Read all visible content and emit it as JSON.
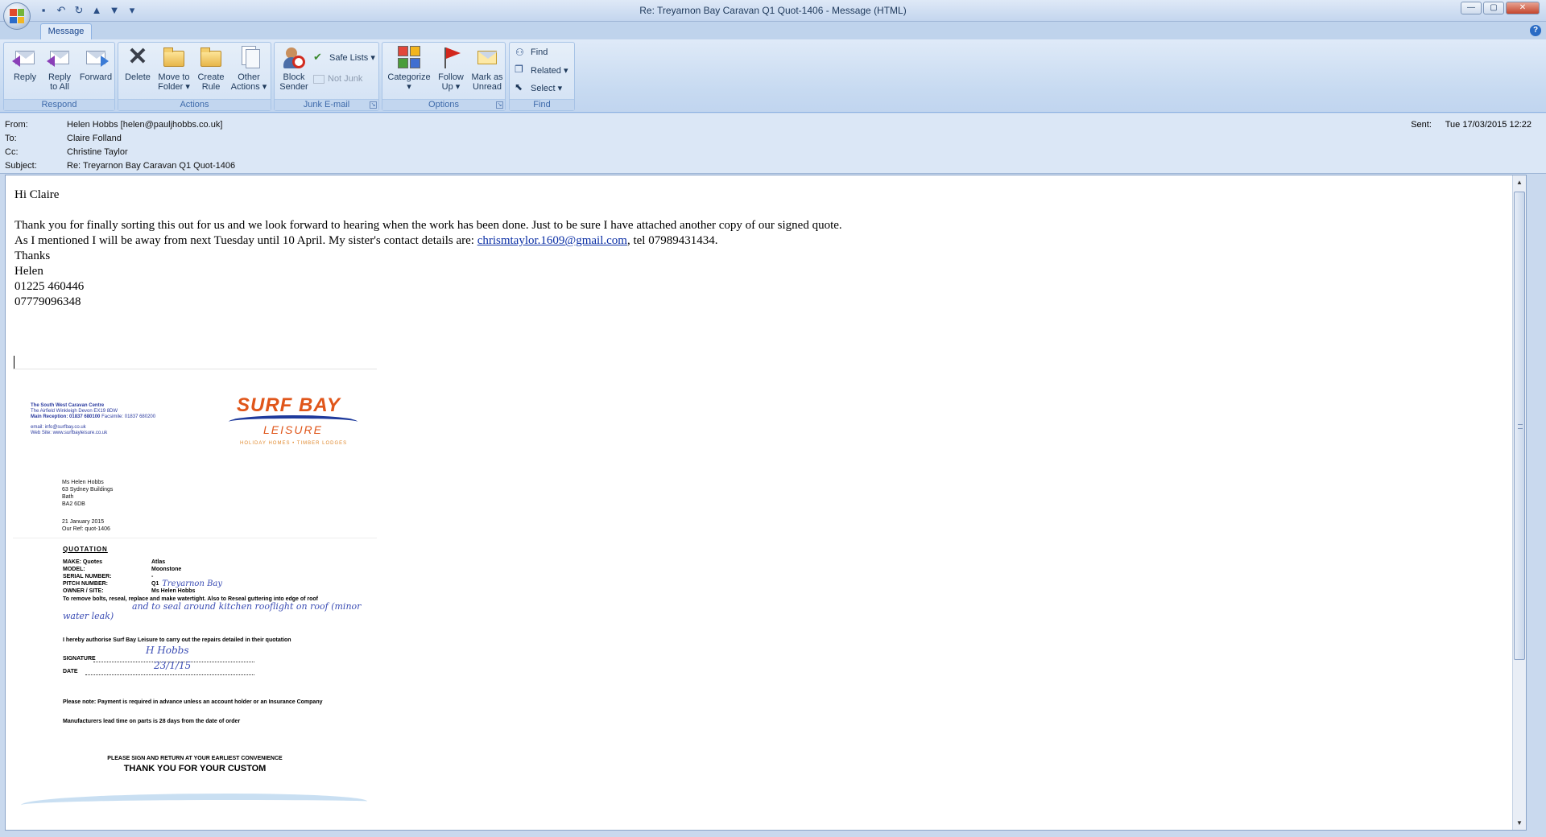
{
  "window": {
    "title": "Re: Treyarnon Bay Caravan Q1  Quot-1406 - Message (HTML)",
    "controls": [
      "minimize-icon",
      "maximize-icon",
      "close-icon"
    ]
  },
  "qat": {
    "icons": [
      "save-icon",
      "undo-icon",
      "redo-icon",
      "previous-icon",
      "next-icon",
      "customize-icon"
    ]
  },
  "tabs": [
    {
      "label": "Message",
      "active": true
    }
  ],
  "ribbon": {
    "groups": {
      "respond": {
        "label": "Respond",
        "buttons": {
          "reply": "Reply",
          "reply_all": "Reply\nto All",
          "forward": "Forward"
        }
      },
      "actions": {
        "label": "Actions",
        "buttons": {
          "delete": "Delete",
          "move_to_folder": "Move to\nFolder ▾",
          "create_rule": "Create\nRule",
          "other_actions": "Other\nActions ▾"
        }
      },
      "junk": {
        "label": "Junk E-mail",
        "buttons": {
          "block_sender": "Block\nSender",
          "safe_lists": "Safe Lists ▾",
          "not_junk": "Not Junk"
        }
      },
      "options": {
        "label": "Options",
        "buttons": {
          "categorize": "Categorize\n▾",
          "follow_up": "Follow\nUp ▾",
          "mark_unread": "Mark as\nUnread"
        }
      },
      "find": {
        "label": "Find",
        "buttons": {
          "find": "Find",
          "related": "Related ▾",
          "select": "Select ▾"
        }
      }
    }
  },
  "header": {
    "from_label": "From:",
    "from": "Helen Hobbs [helen@pauljhobbs.co.uk]",
    "to_label": "To:",
    "to": "Claire Folland",
    "cc_label": "Cc:",
    "cc": "Christine Taylor",
    "subject_label": "Subject:",
    "subject": "Re: Treyarnon Bay Caravan Q1  Quot-1406",
    "sent_label": "Sent:",
    "sent": "Tue 17/03/2015 12:22"
  },
  "body": {
    "greeting": "Hi Claire",
    "line1": "Thank you for finally sorting this out for us and we look forward to hearing when the work has been done.  Just to be sure I have attached another copy of our signed quote.",
    "line2_pre": "As I mentioned I will be away from next Tuesday until 10 April.  My sister's contact details are: ",
    "line2_link": "chrismtaylor.1609@gmail.com",
    "line2_post": ", tel 07989431434.",
    "thanks": "Thanks",
    "name": "Helen",
    "phone1": "01225 460446",
    "phone2": "07779096348"
  },
  "quote": {
    "company_name": "The South West Caravan Centre",
    "company_addr": "The Airfield Winkleigh Devon EX19 8DW",
    "company_reception_label": "Main Reception:",
    "company_reception": "01837 680100",
    "company_fax": "Facsimile: 01837 680200",
    "company_email": "email: info@surfbay.co.uk",
    "company_web": "Web Site: www.surfbayleisure.co.uk",
    "logo_top": "SURF BAY",
    "logo_bottom": "LEISURE",
    "tagline": "HOLIDAY HOMES • TIMBER LODGES",
    "address": "Ms Helen Hobbs\n63 Sydney Buildings\nBath\nBA2 6DB",
    "date_ref": "21 January 2015\nOur Ref: quot-1406",
    "title": "QUOTATION",
    "fields": [
      {
        "k": "MAKE: Quotes",
        "v": "Atlas",
        "hand": ""
      },
      {
        "k": "MODEL:",
        "v": "Moonstone",
        "hand": ""
      },
      {
        "k": "SERIAL NUMBER:",
        "v": "-",
        "hand": ""
      },
      {
        "k": "PITCH NUMBER:",
        "v": "Q1",
        "hand": "Treyarnon Bay"
      },
      {
        "k": "OWNER / SITE:",
        "v": "Ms Helen Hobbs",
        "hand": ""
      }
    ],
    "work": "To remove bolts, reseal, replace and make watertight.  Also to Reseal guttering into edge of roof",
    "work_hand": "and to seal around kitchen rooflight on roof (minor water leak)",
    "authorise": "I hereby authorise Surf Bay Leisure to carry out the repairs detailed in their quotation",
    "signature_label": "SIGNATURE",
    "signature_hand": "H Hobbs",
    "date_label": "DATE",
    "date_hand": "23/1/15",
    "note": "Please note:  Payment is required in advance unless an account holder or an Insurance Company",
    "lead_time": "Manufacturers lead time on parts is 28 days from the date of order",
    "please_sign": "PLEASE SIGN AND RETURN AT YOUR EARLIEST CONVENIENCE",
    "thanks": "THANK YOU FOR YOUR CUSTOM"
  },
  "colors": {
    "accent": "#15428b",
    "link": "#0b2fa5",
    "ribbon": "#c7daf1",
    "logo_orange": "#e0561a",
    "logo_blue": "#1e3a9c"
  }
}
